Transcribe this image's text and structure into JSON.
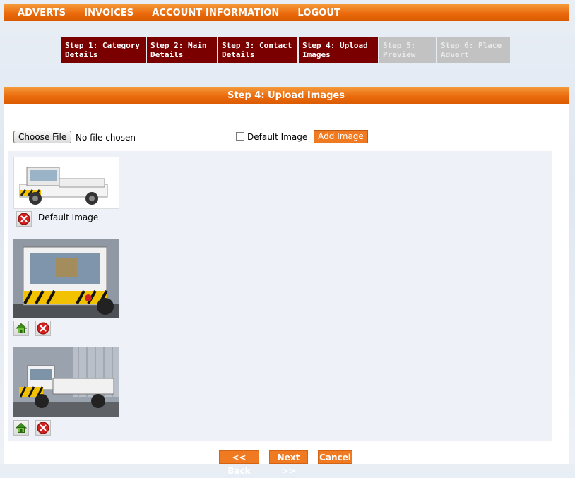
{
  "topnav": {
    "items": [
      "ADVERTS",
      "INVOICES",
      "ACCOUNT INFORMATION",
      "LOGOUT"
    ]
  },
  "steps": [
    {
      "line1": "Step 1: Category",
      "line2": "Details",
      "state": "done"
    },
    {
      "line1": "Step 2: Main",
      "line2": "Details",
      "state": "done"
    },
    {
      "line1": "Step 3: Contact",
      "line2": "Details",
      "state": "done"
    },
    {
      "line1": "Step 4: Upload",
      "line2": "Images",
      "state": "done"
    },
    {
      "line1": "Step 5:",
      "line2": "Preview",
      "state": "todo"
    },
    {
      "line1": "Step 6: Place",
      "line2": "Advert",
      "state": "todo"
    }
  ],
  "section": {
    "title": "Step 4: Upload Images"
  },
  "upload": {
    "choose_file_label": "Choose File",
    "no_file_text": "No file chosen",
    "default_checkbox_label": "Default Image",
    "add_image_label": "Add Image"
  },
  "images": [
    {
      "default_label": "Default Image",
      "icons": [
        "delete-icon"
      ]
    },
    {
      "icons": [
        "home-icon",
        "delete-icon"
      ]
    },
    {
      "icons": [
        "home-icon",
        "delete-icon"
      ]
    }
  ],
  "footer": {
    "back_label": "<< Back",
    "next_label": "Next >>",
    "cancel_label": "Cancel"
  },
  "colors": {
    "accent": "#ea6a0c",
    "step_done": "#7a0000",
    "step_todo": "#c2c2c2"
  }
}
